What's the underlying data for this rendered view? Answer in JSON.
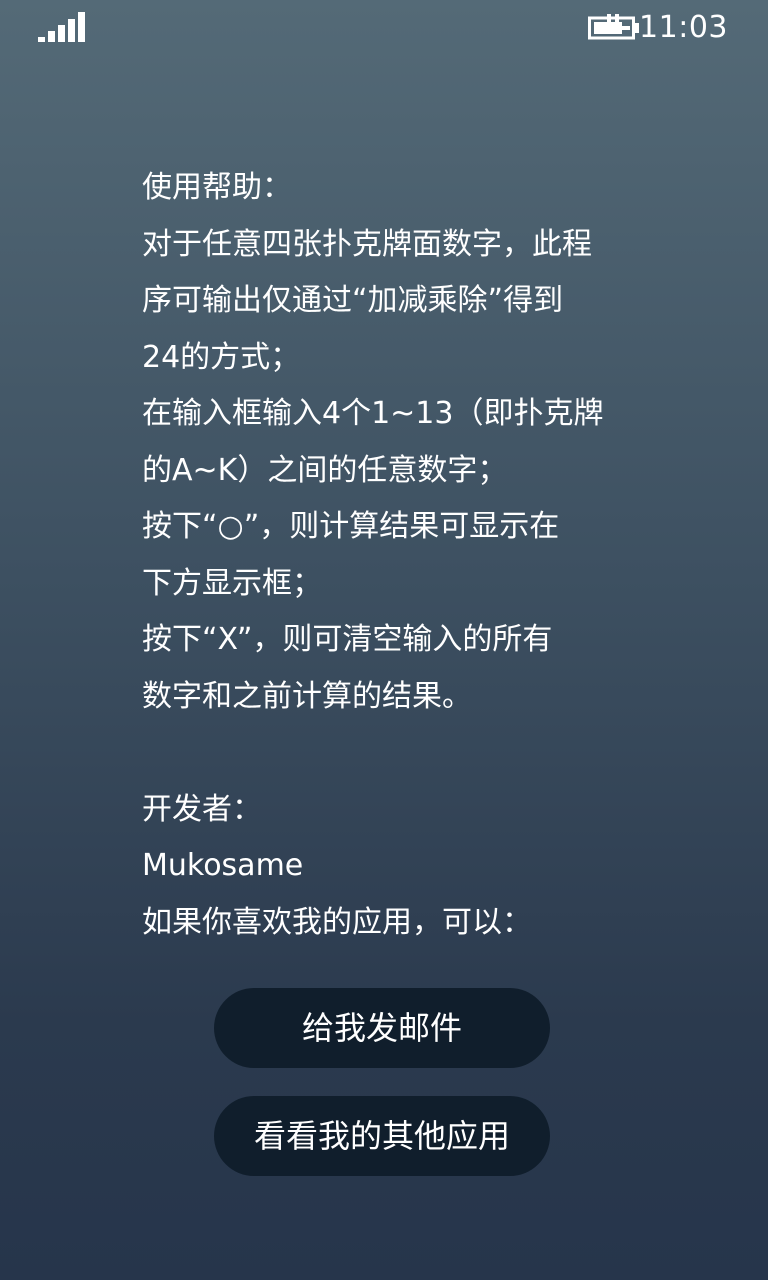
{
  "status_bar": {
    "signal_icon": "signal-strength-icon",
    "battery_icon": "battery-charging-icon",
    "time": "11:03"
  },
  "help": {
    "lines": [
      "使用帮助：",
      "对于任意四张扑克牌面数字，此程",
      "序可输出仅通过“加减乘除”得到",
      "24的方式；",
      "在输入框输入4个1~13（即扑克牌",
      "的A~K）之间的任意数字；",
      "按下“○”，则计算结果可显示在",
      "下方显示框；",
      "按下“X”，则可清空输入的所有",
      "数字和之前计算的结果。"
    ],
    "developer_label": "开发者：",
    "developer_name": "Mukosame",
    "like_prompt": "如果你喜欢我的应用，可以："
  },
  "buttons": {
    "email_label": "给我发邮件",
    "other_apps_label": "看看我的其他应用"
  }
}
